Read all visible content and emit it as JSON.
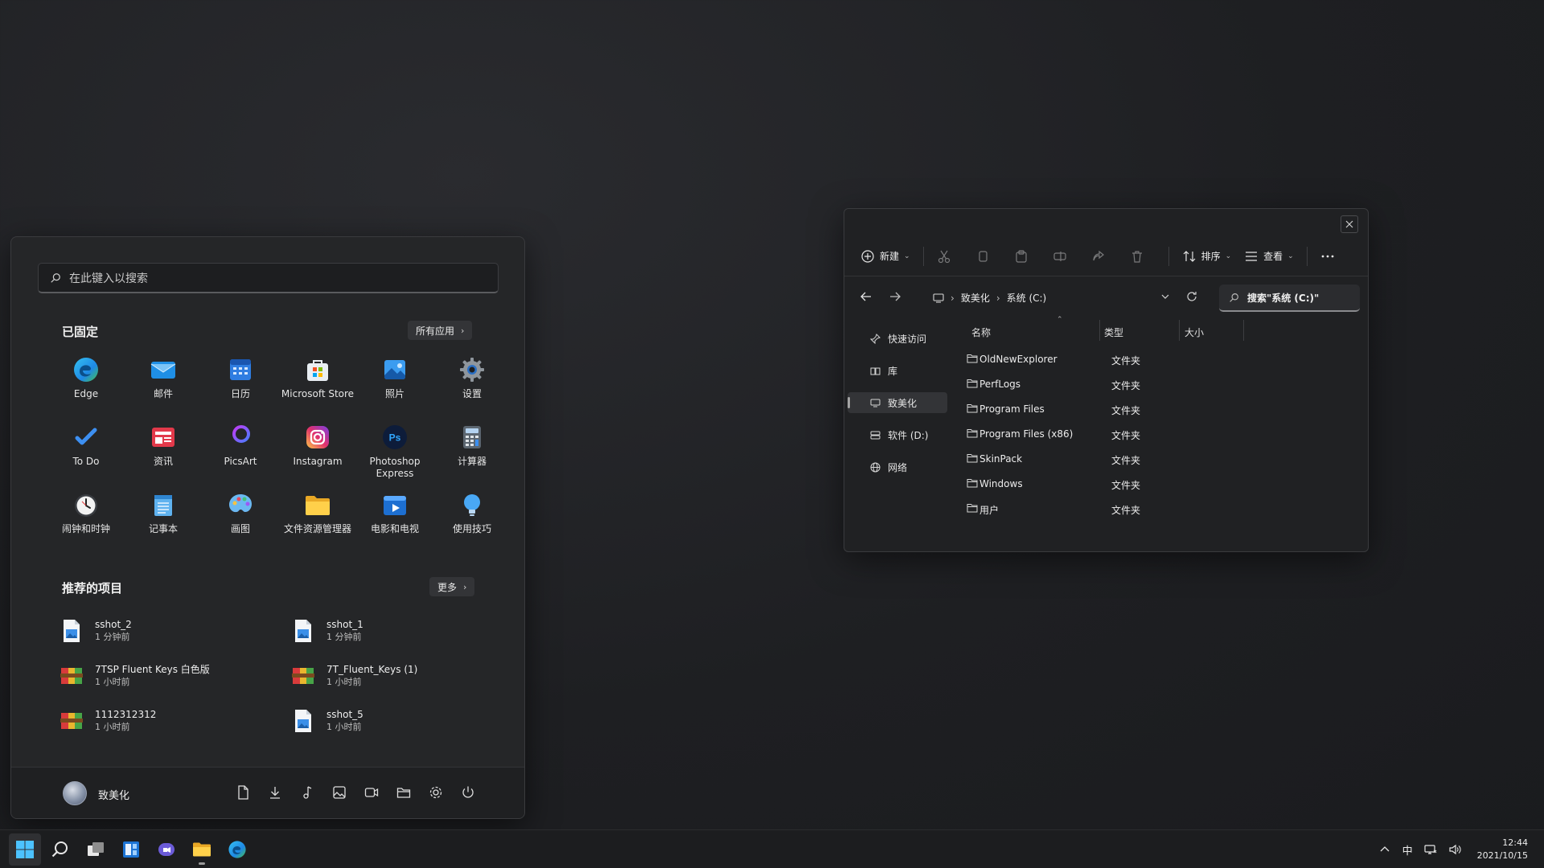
{
  "start_menu": {
    "search_placeholder": "在此键入以搜索",
    "pinned_title": "已固定",
    "all_apps_label": "所有应用",
    "pinned": [
      {
        "label": "Edge",
        "icon": "edge-icon"
      },
      {
        "label": "邮件",
        "icon": "mail-icon"
      },
      {
        "label": "日历",
        "icon": "calendar-icon"
      },
      {
        "label": "Microsoft Store",
        "icon": "store-icon"
      },
      {
        "label": "照片",
        "icon": "photos-icon"
      },
      {
        "label": "设置",
        "icon": "settings-icon"
      },
      {
        "label": "To Do",
        "icon": "todo-icon"
      },
      {
        "label": "资讯",
        "icon": "news-icon"
      },
      {
        "label": "PicsArt",
        "icon": "picsart-icon"
      },
      {
        "label": "Instagram",
        "icon": "instagram-icon"
      },
      {
        "label": "Photoshop Express",
        "icon": "photoshop-icon"
      },
      {
        "label": "计算器",
        "icon": "calculator-icon"
      },
      {
        "label": "闹钟和时钟",
        "icon": "clock-icon"
      },
      {
        "label": "记事本",
        "icon": "notepad-icon"
      },
      {
        "label": "画图",
        "icon": "paint-icon"
      },
      {
        "label": "文件资源管理器",
        "icon": "folder-icon"
      },
      {
        "label": "电影和电视",
        "icon": "movies-icon"
      },
      {
        "label": "使用技巧",
        "icon": "tips-icon"
      }
    ],
    "recommended_title": "推荐的项目",
    "more_label": "更多",
    "recommended": [
      {
        "name": "sshot_2",
        "time": "1 分钟前",
        "icon": "image-file-icon"
      },
      {
        "name": "sshot_1",
        "time": "1 分钟前",
        "icon": "image-file-icon"
      },
      {
        "name": "7TSP Fluent Keys 白色版",
        "time": "1 小时前",
        "icon": "archive-icon"
      },
      {
        "name": "7T_Fluent_Keys (1)",
        "time": "1 小时前",
        "icon": "archive-icon"
      },
      {
        "name": "1112312312",
        "time": "1 小时前",
        "icon": "archive-icon"
      },
      {
        "name": "sshot_5",
        "time": "1 小时前",
        "icon": "image-file-icon"
      }
    ],
    "user_name": "致美化",
    "footer_icons": [
      "document-icon",
      "download-icon",
      "music-icon",
      "pictures-icon",
      "video-icon",
      "folder-icon",
      "gear-icon",
      "power-icon"
    ]
  },
  "explorer": {
    "ribbon": {
      "new_label": "新建",
      "sort_label": "排序",
      "view_label": "查看"
    },
    "breadcrumb": [
      "致美化",
      "系统 (C:)"
    ],
    "search_placeholder": "搜索\"系统 (C:)\"",
    "nav_items": [
      {
        "label": "快速访问",
        "icon": "pin-icon",
        "selected": false
      },
      {
        "label": "库",
        "icon": "library-icon",
        "selected": false
      },
      {
        "label": "致美化",
        "icon": "computer-icon",
        "selected": true
      },
      {
        "label": "软件 (D:)",
        "icon": "drive-icon",
        "selected": false
      },
      {
        "label": "网络",
        "icon": "network-icon",
        "selected": false
      }
    ],
    "columns": {
      "name": "名称",
      "type": "类型",
      "size": "大小"
    },
    "files": [
      {
        "name": "OldNewExplorer",
        "type": "文件夹"
      },
      {
        "name": "PerfLogs",
        "type": "文件夹"
      },
      {
        "name": "Program Files",
        "type": "文件夹"
      },
      {
        "name": "Program Files (x86)",
        "type": "文件夹"
      },
      {
        "name": "SkinPack",
        "type": "文件夹"
      },
      {
        "name": "Windows",
        "type": "文件夹"
      },
      {
        "name": "用户",
        "type": "文件夹"
      }
    ]
  },
  "taskbar": {
    "ime_label": "中",
    "time": "12:44",
    "date": "2021/10/15"
  },
  "colors": {
    "accent": "#4cc2ff",
    "background": "#1e1f22",
    "panel": "#252628"
  }
}
